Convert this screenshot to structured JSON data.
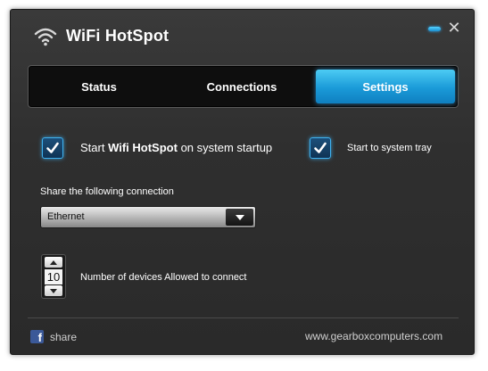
{
  "app": {
    "title": "WiFi HotSpot"
  },
  "tabs": [
    {
      "label": "Status",
      "active": false
    },
    {
      "label": "Connections",
      "active": false
    },
    {
      "label": "Settings",
      "active": true
    }
  ],
  "settings": {
    "startup_prefix": "Start ",
    "startup_bold": "Wifi HotSpot",
    "startup_suffix": " on system startup",
    "startup_checked": true,
    "tray_label": "Start to system tray",
    "tray_checked": true,
    "share_label": "Share the following connection",
    "share_value": "Ethernet",
    "devices_value": "10",
    "devices_label": "Number of devices Allowed to connect"
  },
  "footer": {
    "share_label": "share",
    "site": "www.gearboxcomputers.com"
  },
  "colors": {
    "accent": "#1a9ad8",
    "window_bg": "#2f2f2f",
    "facebook": "#3b5998"
  }
}
